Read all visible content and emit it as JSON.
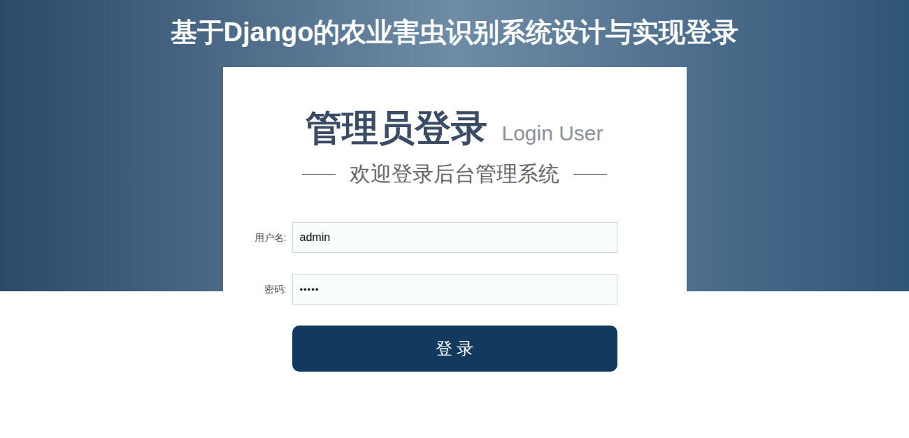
{
  "page": {
    "title": "基于Django的农业害虫识别系统设计与实现登录"
  },
  "login_card": {
    "heading": "管理员登录",
    "heading_en": "Login User",
    "subtitle": "欢迎登录后台管理系统"
  },
  "fields": [
    {
      "label": "用户名:",
      "value": "admin",
      "kind": "text"
    },
    {
      "label": "密码:",
      "value": "•••••",
      "kind": "password"
    }
  ],
  "button": "登 录"
}
